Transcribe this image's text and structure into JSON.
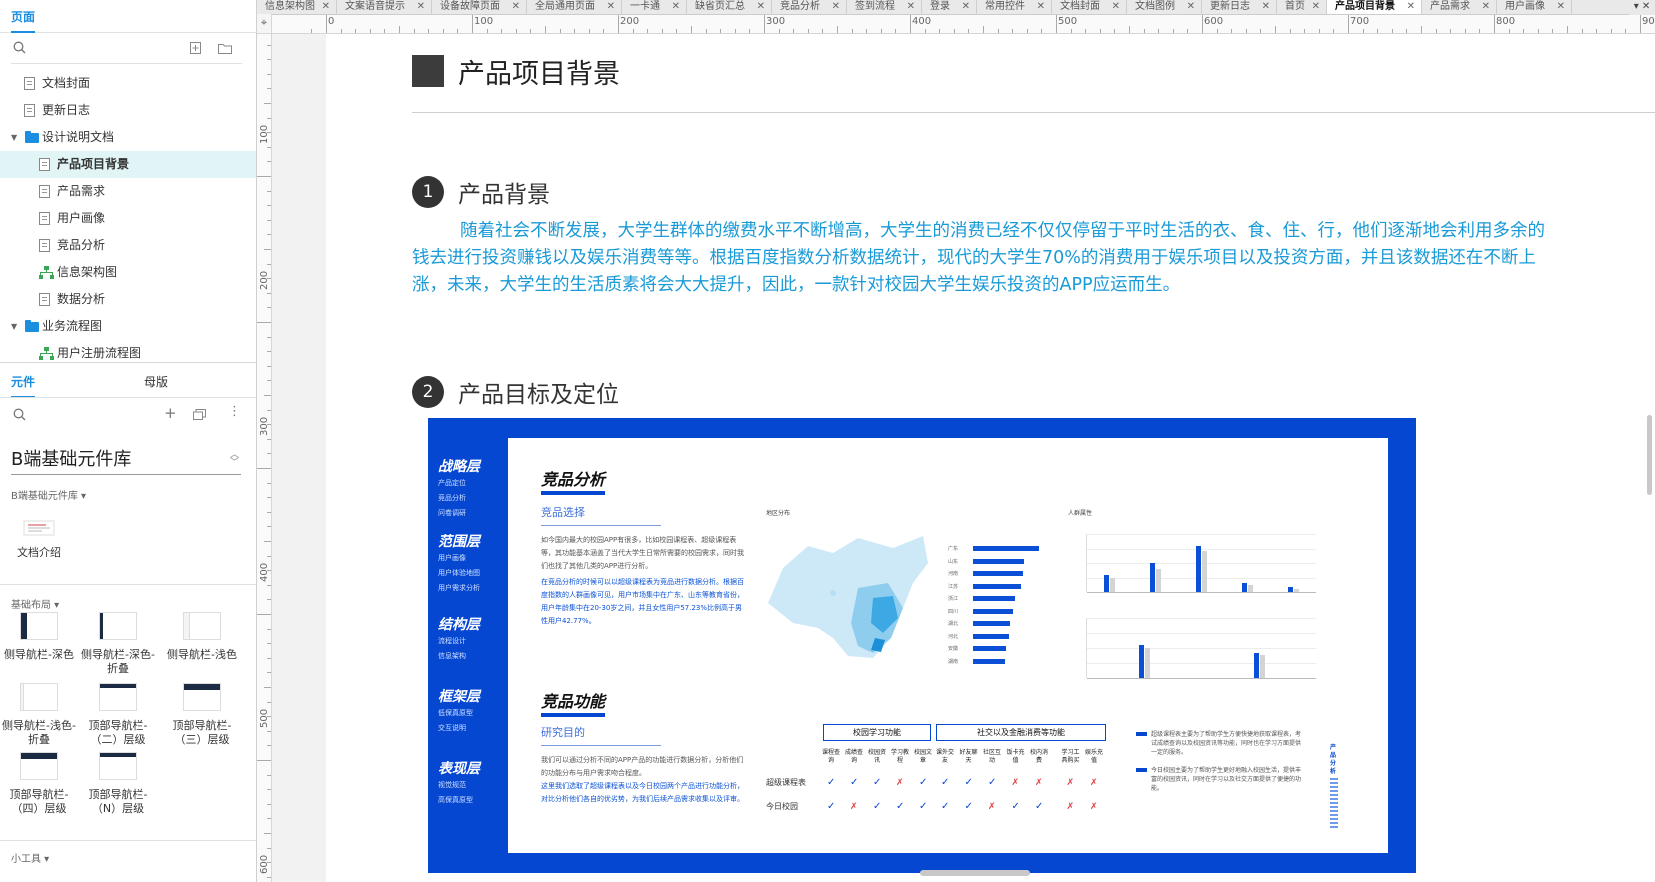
{
  "left_panel": {
    "pages_tab": "页面",
    "tree": [
      {
        "label": "文档封面",
        "type": "page",
        "depth": 1
      },
      {
        "label": "更新日志",
        "type": "page",
        "depth": 1
      },
      {
        "label": "设计说明文档",
        "type": "folder",
        "depth": 0
      },
      {
        "label": "产品项目背景",
        "type": "page",
        "depth": 2,
        "selected": true
      },
      {
        "label": "产品需求",
        "type": "page",
        "depth": 2
      },
      {
        "label": "用户画像",
        "type": "page",
        "depth": 2
      },
      {
        "label": "竞品分析",
        "type": "page",
        "depth": 2
      },
      {
        "label": "信息架构图",
        "type": "flow",
        "depth": 2
      },
      {
        "label": "数据分析",
        "type": "page",
        "depth": 2
      },
      {
        "label": "业务流程图",
        "type": "folder",
        "depth": 0
      },
      {
        "label": "用户注册流程图",
        "type": "flow",
        "depth": 2
      }
    ],
    "components_tab": "元件",
    "masters_tab": "母版",
    "library_name": "B端基础元件库",
    "library_section": "B端基础元件库 ▾",
    "doc_component": "文档介绍",
    "layout_section": "基础布局 ▾",
    "components": [
      {
        "label": "侧导航栏-深色"
      },
      {
        "label": "侧导航栏-深色-折叠"
      },
      {
        "label": "侧导航栏-浅色"
      },
      {
        "label": "侧导航栏-浅色-折叠"
      },
      {
        "label": "顶部导航栏-（二）层级"
      },
      {
        "label": "顶部导航栏-（三）层级"
      },
      {
        "label": "顶部导航栏-（四）层级"
      },
      {
        "label": "顶部导航栏-（N）层级"
      }
    ],
    "tools_section": "小工具 ▾"
  },
  "doc_tabs": [
    "信息架构图",
    "文案语音提示",
    "设备故障页面",
    "全局通用页面",
    "一卡通",
    "缺省页汇总",
    "竞品分析",
    "签到流程",
    "登录",
    "常用控件",
    "文档封面",
    "文档图例",
    "更新日志",
    "首页",
    "产品项目背景",
    "产品需求",
    "用户画像"
  ],
  "active_tab": "产品项目背景",
  "ruler": {
    "h_labels": [
      "0",
      "100",
      "200",
      "300",
      "400",
      "500",
      "600",
      "700",
      "800",
      "900"
    ],
    "v_labels": [
      "100",
      "200",
      "300",
      "400",
      "500",
      "600"
    ]
  },
  "page": {
    "title": "产品项目背景",
    "section1": {
      "num": "1",
      "title": "产品背景"
    },
    "paragraph": "随着社会不断发展，大学生群体的缴费水平不断增高，大学生的消费已经不仅仅停留于平时生活的衣、食、住、行，他们逐渐地会利用多余的钱去进行投资赚钱以及娱乐消费等等。根据百度指数分析数据统计，现代的大学生70%的消费用于娱乐项目以及投资方面，并且该数据还在不断上涨，未来，大学生的生活质素将会大大提升，因此，一款针对校园大学生娱乐投资的APP应运而生。",
    "section2": {
      "num": "2",
      "title": "产品目标及定位"
    }
  },
  "infographic": {
    "layers": [
      {
        "name": "战略层",
        "subs": [
          "产品定位",
          "竞品分析",
          "问卷调研"
        ]
      },
      {
        "name": "范围层",
        "subs": [
          "用户画像",
          "用户体验地图",
          "用户需求分析"
        ]
      },
      {
        "name": "结构层",
        "subs": [
          "流程设计",
          "信息架构"
        ]
      },
      {
        "name": "框架层",
        "subs": [
          "低保真原型",
          "交互说明"
        ]
      },
      {
        "name": "表现层",
        "subs": [
          "视觉规范",
          "高保真原型"
        ]
      }
    ],
    "title1": "竞品分析",
    "sub1": "竞品选择",
    "text1": "如今国内最大的校园APP有很多，比如校园课程表、超级课程表等，其功能基本涵盖了当代大学生日常所需要的校园需求，同时我们也找了其他几类的APP进行分析。",
    "text1b": "在竞品分析的时候可以以超级课程表为竞品进行数据分析。根据百度指数的人群画像可见，用户市场集中在广东、山东等教育省份，用户年龄集中在20-30岁之间，并且女性用户57.23%比例高于男性用户42.77%。",
    "map_label": "地区分布",
    "chart_label": "人群属性",
    "title2": "竞品功能",
    "sub2": "研究目的",
    "text2": "我们可以通过分析不同的APP产品的功能进行数据分析，分析他们的功能分布与用户需求吻合程度。",
    "text2b": "这里我们选取了超级课程表以及今日校园两个产品进行功能分析，对比分析他们各自的优劣势，为我们后续产品需求收集以及评审。",
    "table_h1": "校园学习功能",
    "table_h2": "社交以及金融消费等功能",
    "columns": [
      "课程查询",
      "成绩查询",
      "校园资讯",
      "学习教程",
      "校园文章",
      "课外交友",
      "好友聊天",
      "社区互动",
      "饭卡充值",
      "校内消费",
      "学习工具购买",
      "娱乐充值"
    ],
    "rows": [
      {
        "name": "超级课程表",
        "marks": [
          "✓",
          "✓",
          "✓",
          "✗",
          "✓",
          "✓",
          "✓",
          "✓",
          "✗",
          "✗",
          "✗",
          "✗"
        ]
      },
      {
        "name": "今日校园",
        "marks": [
          "✓",
          "✗",
          "✓",
          "✓",
          "✓",
          "✓",
          "✓",
          "✗",
          "✓",
          "✓",
          "✗",
          "✗"
        ]
      }
    ],
    "legend": [
      {
        "text": "超级课程表主要为了帮助学生方便快捷地获取课程表，考试成绩查询以及校园资讯等功能，同时也在学习方面提供一定的服务。"
      },
      {
        "text": "今日校园主要为了帮助学生更好地融入校园生活，提供丰富的校园资讯，同时在学习以及社交方面提供了便捷的功能。"
      }
    ],
    "side_vertical": "产品分析",
    "bar_cats": [
      "广东",
      "山东",
      "河南",
      "江苏",
      "浙江",
      "四川",
      "湖北",
      "河北",
      "安徽",
      "湖南"
    ],
    "bar_values": [
      100,
      78,
      76,
      72,
      64,
      60,
      56,
      54,
      50,
      48
    ],
    "age_values_a": [
      30,
      50,
      80,
      15,
      8
    ],
    "age_values_b": [
      25,
      40,
      70,
      12,
      6
    ],
    "gender_values_a": [
      55,
      42
    ],
    "gender_values_b": [
      50,
      38
    ]
  },
  "colors": {
    "accent": "#1a8ee0",
    "para": "#1a9ad6",
    "info_blue": "#0647d1",
    "selected_bg": "#e1f5f6"
  }
}
